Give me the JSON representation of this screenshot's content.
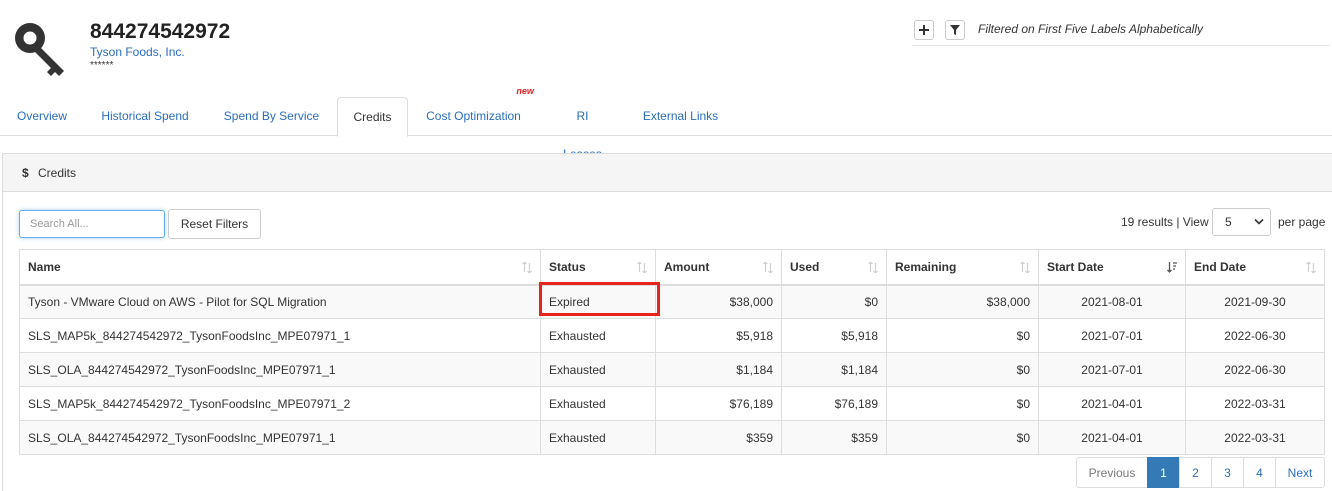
{
  "header": {
    "account_id": "844274542972",
    "account_name": "Tyson Foods, Inc.",
    "masked": "******",
    "filter_text": "Filtered on First Five Labels Alphabetically"
  },
  "tabs": [
    {
      "label": "Overview"
    },
    {
      "label": "Historical Spend"
    },
    {
      "label": "Spend By Service"
    },
    {
      "label": "Credits",
      "active": true
    },
    {
      "label": "Cost Optimization",
      "badge": "new"
    },
    {
      "label": "RI Leases"
    },
    {
      "label": "External Links"
    }
  ],
  "panel": {
    "icon": "$",
    "title": "Credits"
  },
  "toolbar": {
    "search_placeholder": "Search All...",
    "reset_label": "Reset Filters",
    "results_text": "19 results | View",
    "view_value": "5",
    "per_page_text": "per page"
  },
  "table": {
    "columns": [
      "Name",
      "Status",
      "Amount",
      "Used",
      "Remaining",
      "Start Date",
      "End Date"
    ],
    "rows": [
      [
        "Tyson - VMware Cloud on AWS - Pilot for SQL Migration",
        "Expired",
        "$38,000",
        "$0",
        "$38,000",
        "2021-08-01",
        "2021-09-30"
      ],
      [
        "SLS_MAP5k_844274542972_TysonFoodsInc_MPE07971_1",
        "Exhausted",
        "$5,918",
        "$5,918",
        "$0",
        "2021-07-01",
        "2022-06-30"
      ],
      [
        "SLS_OLA_844274542972_TysonFoodsInc_MPE07971_1",
        "Exhausted",
        "$1,184",
        "$1,184",
        "$0",
        "2021-07-01",
        "2022-06-30"
      ],
      [
        "SLS_MAP5k_844274542972_TysonFoodsInc_MPE07971_2",
        "Exhausted",
        "$76,189",
        "$76,189",
        "$0",
        "2021-04-01",
        "2022-03-31"
      ],
      [
        "SLS_OLA_844274542972_TysonFoodsInc_MPE07971_1",
        "Exhausted",
        "$359",
        "$359",
        "$0",
        "2021-04-01",
        "2022-03-31"
      ]
    ]
  },
  "pagination": {
    "previous": "Previous",
    "pages": [
      "1",
      "2",
      "3",
      "4"
    ],
    "current": "1",
    "next": "Next"
  },
  "colors": {
    "link": "#2a6ebb",
    "active_page": "#337ab7",
    "highlight": "#e8231a",
    "new_badge": "#e02020"
  },
  "icons": {
    "account": "key-icon",
    "add": "plus-icon",
    "filter": "filter-icon",
    "sort": "sort-icon",
    "sort_active": "sort-desc-icon",
    "dropdown": "chevron-down-icon"
  }
}
